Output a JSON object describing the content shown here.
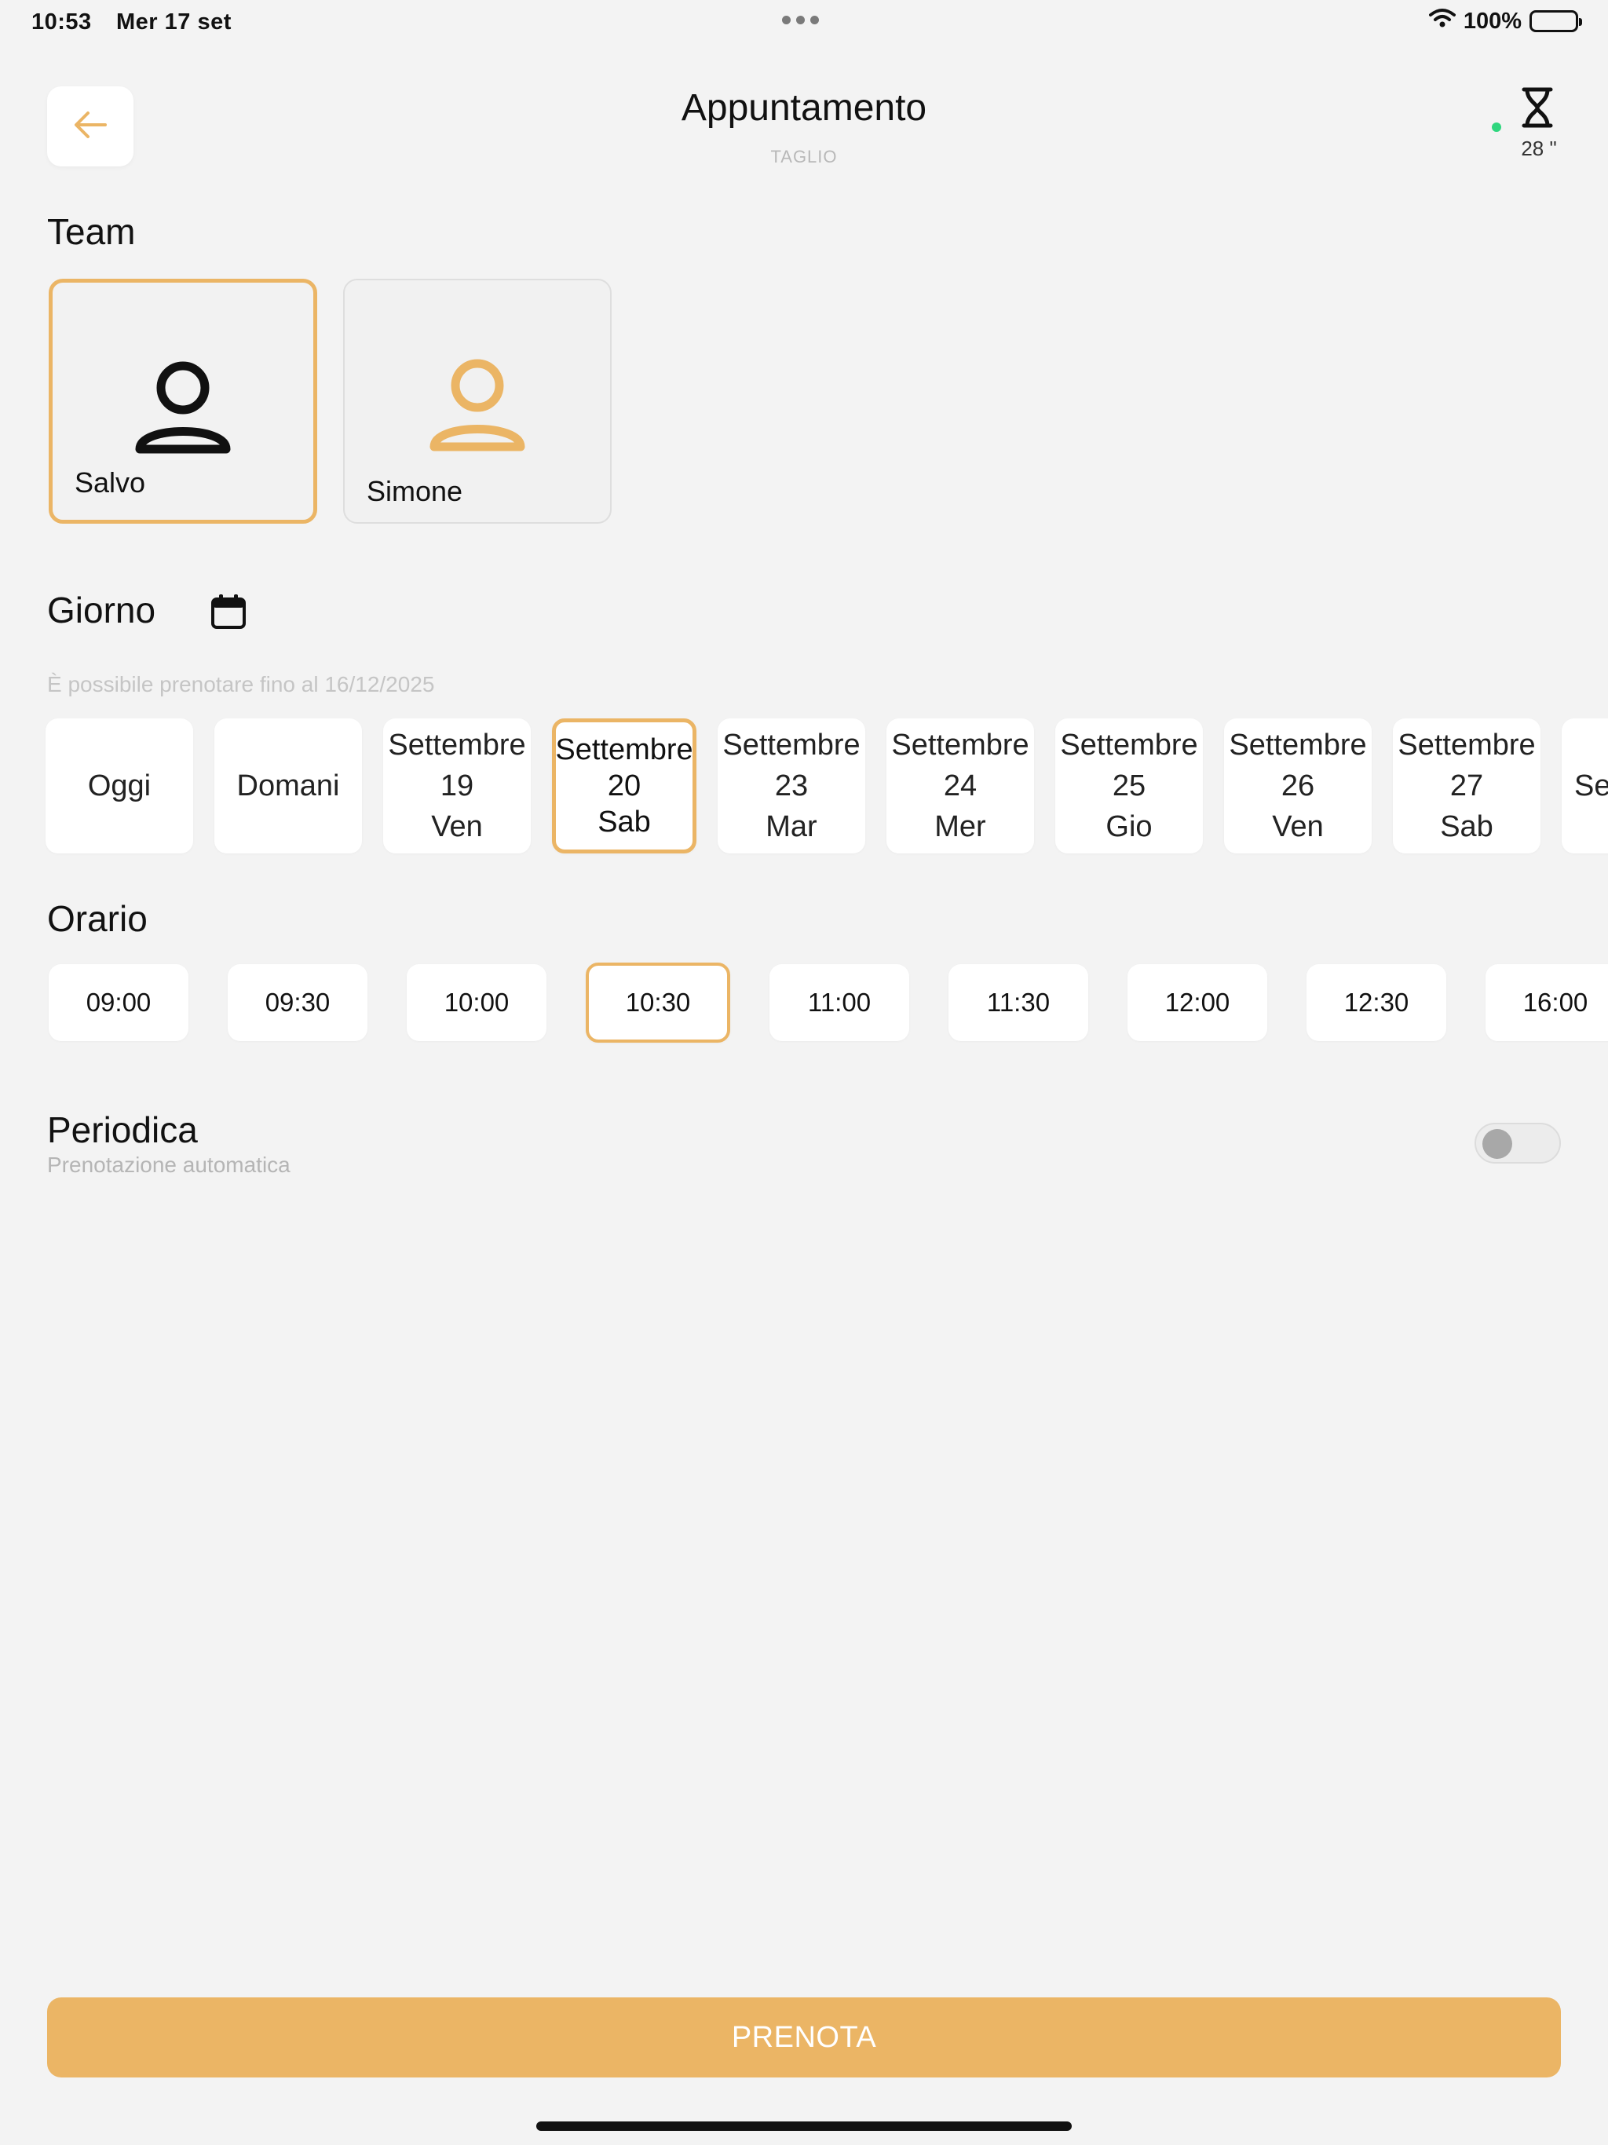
{
  "status_bar": {
    "time": "10:53",
    "date": "Mer 17 set",
    "battery": "100%"
  },
  "header": {
    "title": "Appuntamento",
    "subtitle": "TAGLIO",
    "timer": "28 \""
  },
  "team": {
    "title": "Team",
    "members": [
      {
        "name": "Salvo",
        "selected": true
      },
      {
        "name": "Simone",
        "selected": false
      }
    ]
  },
  "day": {
    "title": "Giorno",
    "hint": "È possibile prenotare fino al 16/12/2025",
    "options": [
      {
        "label": "Oggi"
      },
      {
        "label": "Domani"
      },
      {
        "month": "Settembre",
        "day": "19",
        "weekday": "Ven"
      },
      {
        "month": "Settembre",
        "day": "20",
        "weekday": "Sab",
        "selected": true
      },
      {
        "month": "Settembre",
        "day": "23",
        "weekday": "Mar"
      },
      {
        "month": "Settembre",
        "day": "24",
        "weekday": "Mer"
      },
      {
        "month": "Settembre",
        "day": "25",
        "weekday": "Gio"
      },
      {
        "month": "Settembre",
        "day": "26",
        "weekday": "Ven"
      },
      {
        "month": "Settembre",
        "day": "27",
        "weekday": "Sab"
      },
      {
        "month": "Settembre",
        "day": "",
        "weekday": ""
      }
    ]
  },
  "time": {
    "title": "Orario",
    "slots": [
      "09:00",
      "09:30",
      "10:00",
      "10:30",
      "11:00",
      "11:30",
      "12:00",
      "12:30",
      "16:00"
    ],
    "selected": "10:30"
  },
  "periodic": {
    "title": "Periodica",
    "subtitle": "Prenotazione automatica",
    "enabled": false
  },
  "book_button": "PRENOTA",
  "colors": {
    "accent": "#ebb565",
    "background": "#f3f3f3",
    "online": "#2fd67e"
  }
}
